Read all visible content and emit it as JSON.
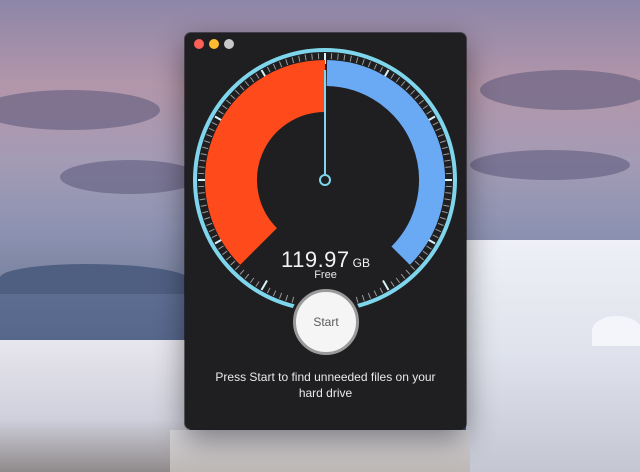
{
  "window": {
    "controls": [
      "close",
      "minimize",
      "zoom"
    ]
  },
  "gauge": {
    "used_fraction": 0.5,
    "free_fraction": 0.5,
    "colors": {
      "used": "#ff4a1c",
      "free": "#6aaaf4",
      "ring": "#7fd6ec",
      "ticks": "#9a9a9a",
      "needle": "#7fd6ec"
    }
  },
  "readout": {
    "value": "119.97",
    "unit": "GB",
    "label": "Free"
  },
  "start_button": {
    "label": "Start"
  },
  "caption": "Press Start to find unneeded files on your hard drive"
}
